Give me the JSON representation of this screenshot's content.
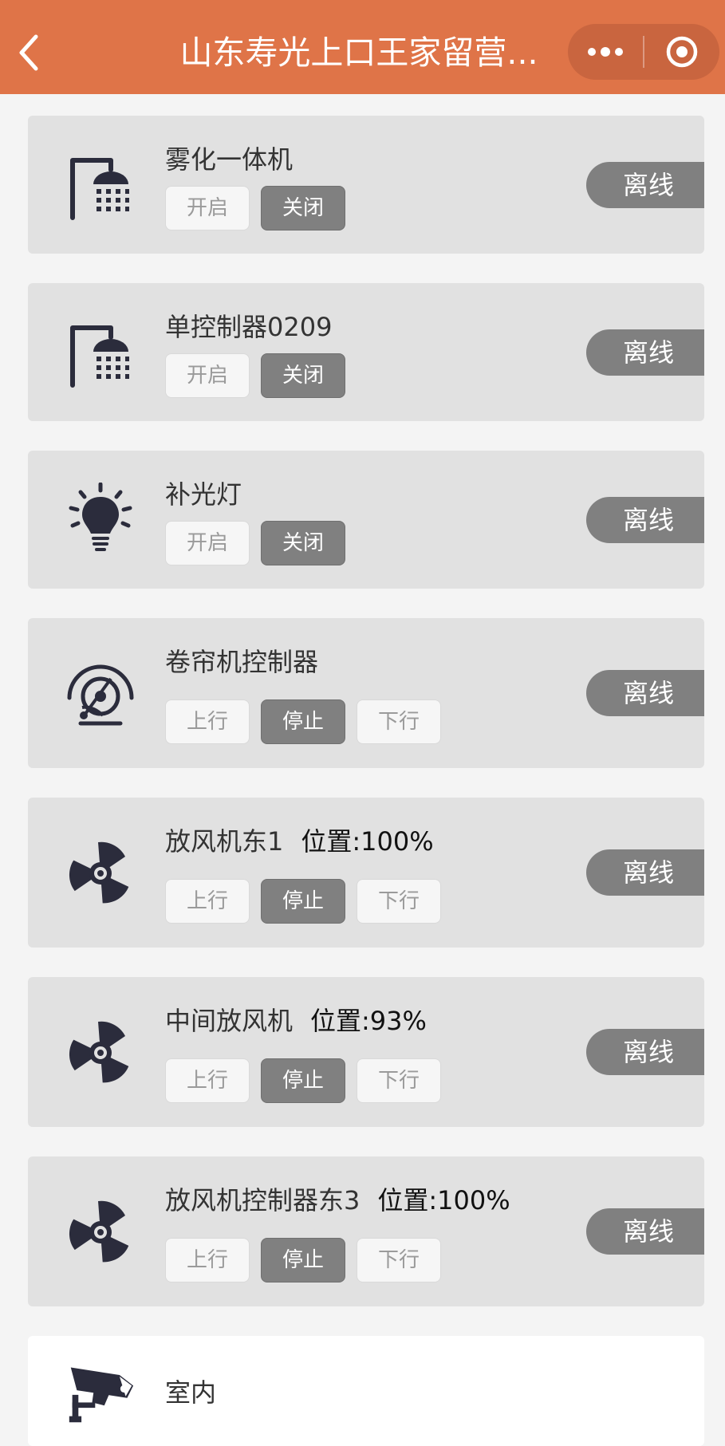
{
  "header": {
    "title": "山东寿光上口王家留营...",
    "back_icon": "chevron-left-icon",
    "more_icon": "more-dots-icon",
    "close_icon": "target-close-icon"
  },
  "devices": [
    {
      "name": "雾化一体机",
      "icon": "shower-icon",
      "buttons": [
        "开启",
        "关闭"
      ],
      "status": "离线"
    },
    {
      "name": "单控制器0209",
      "icon": "shower-icon",
      "buttons": [
        "开启",
        "关闭"
      ],
      "status": "离线"
    },
    {
      "name": "补光灯",
      "icon": "lightbulb-icon",
      "buttons": [
        "开启",
        "关闭"
      ],
      "status": "离线"
    },
    {
      "name": "卷帘机控制器",
      "icon": "roller-shutter-icon",
      "buttons": [
        "上行",
        "停止",
        "下行"
      ],
      "status": "离线"
    },
    {
      "name": "放风机东1",
      "position": "位置:100%",
      "icon": "fan-icon",
      "buttons": [
        "上行",
        "停止",
        "下行"
      ],
      "status": "离线"
    },
    {
      "name": "中间放风机",
      "position": "位置:93%",
      "icon": "fan-icon",
      "buttons": [
        "上行",
        "停止",
        "下行"
      ],
      "status": "离线"
    },
    {
      "name": "放风机控制器东3",
      "position": "位置:100%",
      "icon": "fan-icon",
      "buttons": [
        "上行",
        "停止",
        "下行"
      ],
      "status": "离线"
    }
  ],
  "camera": {
    "name": "室内",
    "icon": "security-camera-icon"
  },
  "colors": {
    "header": "#df7448",
    "card": "#e1e1e1",
    "active_button": "#808080",
    "status_badge": "#808080"
  }
}
